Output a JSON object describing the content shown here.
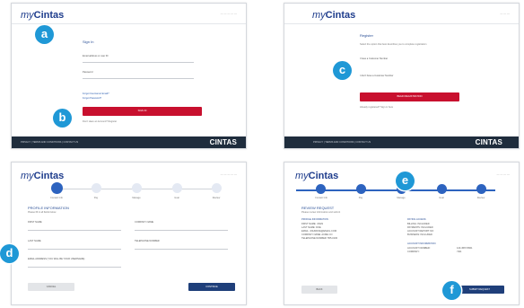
{
  "brand": {
    "my": "my",
    "name": "Cintas",
    "footer_logo": "CINTAS"
  },
  "badges": [
    "a",
    "b",
    "c",
    "d",
    "e",
    "f"
  ],
  "panel_a": {
    "nav": "— —   — — —",
    "title": "Sign In",
    "email_label": "Email address or user ID",
    "password_label": "Password",
    "forgot_email": "Forgot Username/ Email?",
    "forgot_password": "Forgot Password?",
    "signin_button": "SIGN IN",
    "register_text": "Don't Have an Account? Register",
    "footer_text": "PRIVACY  |  TERMS AND CONDITIONS  |  CONTACT US"
  },
  "panel_b": {
    "nav": "— — —",
    "title": "Register",
    "intro": "Select the option that best describes you to complete registration",
    "option1": "I have a Customer Number",
    "option2": "I don't have a Customer Number",
    "button": "BEGIN REGISTRATION",
    "note": "Already registered? Sign in here",
    "footer_text": "PRIVACY  |  TERMS AND CONDITIONS  |  CONTACT US"
  },
  "panel_c": {
    "nav": "— —   — — —",
    "steps": [
      "Contact Info",
      "Pay",
      "Manage",
      "Goal",
      "Review"
    ],
    "section_title": "PROFILE INFORMATION",
    "section_sub": "Please fill in all fields below",
    "first_name": "FIRST NAME",
    "company_name": "COMPANY NAME",
    "last_name": "LAST NAME",
    "telephone": "TELEPHONE NUMBER",
    "email": "EMAIL ADDRESS (YOU WILL BE YOUR USERNAME)",
    "cancel": "CANCEL",
    "continue": "CONTINUE"
  },
  "panel_d": {
    "nav": "— —  — —",
    "steps": [
      "Contact Info",
      "Pay",
      "Manage",
      "Goal",
      "Review"
    ],
    "section_title": "REVIEW REQUEST",
    "section_sub": "Please review information and submit",
    "left_title": "PROFILE INFORMATION",
    "left_lines": [
      "FIRST NAME: JOHN",
      "LAST NAME: DOE",
      "EMAIL: JOHNDOE@EMAIL.COM",
      "COMPANY NAME: ACME CO",
      "TELEPHONE NUMBER: 555-0100"
    ],
    "right_title": "PAYING ACCESS",
    "right_lines": [
      "BILLING: INCLUDED",
      "PAYMENTS: INCLUDED",
      "ACCOUNT REPORT: NO",
      "BUSINESS: INCLUDED"
    ],
    "right_title2": "ACCOUNT INFORMATION",
    "right_lines2": [
      "ACCOUNT NUMBER:",
      "COMPANY:"
    ],
    "right_extra": [
      "123-4567 8901",
      "YES"
    ],
    "back": "BACK",
    "submit": "SUBMIT REQUEST"
  },
  "colors": {
    "brand_blue": "#1e3c8c",
    "badge_blue": "#1f98d6",
    "red": "#c8102e",
    "navy": "#1f3f7a",
    "footer": "#1f2d3d"
  }
}
